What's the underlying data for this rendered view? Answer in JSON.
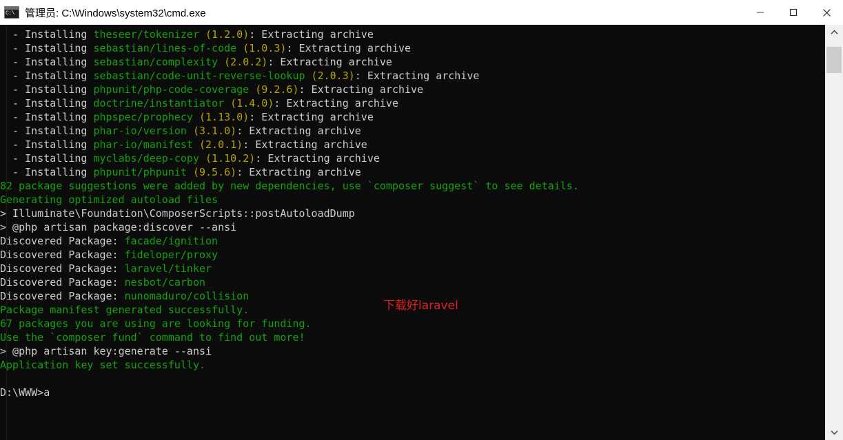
{
  "window": {
    "title": "管理员: C:\\Windows\\system32\\cmd.exe",
    "icon": "cmd-console-icon",
    "icon_prompt": "C:\\",
    "controls": {
      "minimize": "minimize-icon",
      "maximize": "maximize-icon",
      "close": "close-icon"
    }
  },
  "colors": {
    "background": "#0c0c0c",
    "default_text": "#cccccc",
    "green": "#13a10e",
    "yellow": "#b5a300",
    "annotation_red": "#e02020",
    "titlebar_bg": "#ffffff",
    "scrollbar_track": "#f0f0f0",
    "scrollbar_thumb": "#cdcdcd"
  },
  "terminal": {
    "lines": [
      {
        "id": "install-theseer-tokenizer",
        "segments": [
          {
            "text": "  - Installing ",
            "color": "white"
          },
          {
            "text": "theseer/tokenizer",
            "color": "green"
          },
          {
            "text": " ",
            "color": "white"
          },
          {
            "text": "(1.2.0)",
            "color": "yellow"
          },
          {
            "text": ": Extracting archive",
            "color": "white"
          }
        ]
      },
      {
        "id": "install-sebastian-lines-of-code",
        "segments": [
          {
            "text": "  - Installing ",
            "color": "white"
          },
          {
            "text": "sebastian/lines-of-code",
            "color": "green"
          },
          {
            "text": " ",
            "color": "white"
          },
          {
            "text": "(1.0.3)",
            "color": "yellow"
          },
          {
            "text": ": Extracting archive",
            "color": "white"
          }
        ]
      },
      {
        "id": "install-sebastian-complexity",
        "segments": [
          {
            "text": "  - Installing ",
            "color": "white"
          },
          {
            "text": "sebastian/complexity",
            "color": "green"
          },
          {
            "text": " ",
            "color": "white"
          },
          {
            "text": "(2.0.2)",
            "color": "yellow"
          },
          {
            "text": ": Extracting archive",
            "color": "white"
          }
        ]
      },
      {
        "id": "install-sebastian-code-unit-reverse-lookup",
        "segments": [
          {
            "text": "  - Installing ",
            "color": "white"
          },
          {
            "text": "sebastian/code-unit-reverse-lookup",
            "color": "green"
          },
          {
            "text": " ",
            "color": "white"
          },
          {
            "text": "(2.0.3)",
            "color": "yellow"
          },
          {
            "text": ": Extracting archive",
            "color": "white"
          }
        ]
      },
      {
        "id": "install-phpunit-php-code-coverage",
        "segments": [
          {
            "text": "  - Installing ",
            "color": "white"
          },
          {
            "text": "phpunit/php-code-coverage",
            "color": "green"
          },
          {
            "text": " ",
            "color": "white"
          },
          {
            "text": "(9.2.6)",
            "color": "yellow"
          },
          {
            "text": ": Extracting archive",
            "color": "white"
          }
        ]
      },
      {
        "id": "install-doctrine-instantiator",
        "segments": [
          {
            "text": "  - Installing ",
            "color": "white"
          },
          {
            "text": "doctrine/instantiator",
            "color": "green"
          },
          {
            "text": " ",
            "color": "white"
          },
          {
            "text": "(1.4.0)",
            "color": "yellow"
          },
          {
            "text": ": Extracting archive",
            "color": "white"
          }
        ]
      },
      {
        "id": "install-phpspec-prophecy",
        "segments": [
          {
            "text": "  - Installing ",
            "color": "white"
          },
          {
            "text": "phpspec/prophecy",
            "color": "green"
          },
          {
            "text": " ",
            "color": "white"
          },
          {
            "text": "(1.13.0)",
            "color": "yellow"
          },
          {
            "text": ": Extracting archive",
            "color": "white"
          }
        ]
      },
      {
        "id": "install-phar-io-version",
        "segments": [
          {
            "text": "  - Installing ",
            "color": "white"
          },
          {
            "text": "phar-io/version",
            "color": "green"
          },
          {
            "text": " ",
            "color": "white"
          },
          {
            "text": "(3.1.0)",
            "color": "yellow"
          },
          {
            "text": ": Extracting archive",
            "color": "white"
          }
        ]
      },
      {
        "id": "install-phar-io-manifest",
        "segments": [
          {
            "text": "  - Installing ",
            "color": "white"
          },
          {
            "text": "phar-io/manifest",
            "color": "green"
          },
          {
            "text": " ",
            "color": "white"
          },
          {
            "text": "(2.0.1)",
            "color": "yellow"
          },
          {
            "text": ": Extracting archive",
            "color": "white"
          }
        ]
      },
      {
        "id": "install-myclabs-deep-copy",
        "segments": [
          {
            "text": "  - Installing ",
            "color": "white"
          },
          {
            "text": "myclabs/deep-copy",
            "color": "green"
          },
          {
            "text": " ",
            "color": "white"
          },
          {
            "text": "(1.10.2)",
            "color": "yellow"
          },
          {
            "text": ": Extracting archive",
            "color": "white"
          }
        ]
      },
      {
        "id": "install-phpunit-phpunit",
        "segments": [
          {
            "text": "  - Installing ",
            "color": "white"
          },
          {
            "text": "phpunit/phpunit",
            "color": "green"
          },
          {
            "text": " ",
            "color": "white"
          },
          {
            "text": "(9.5.6)",
            "color": "yellow"
          },
          {
            "text": ": Extracting archive",
            "color": "white"
          }
        ]
      },
      {
        "id": "package-suggestions",
        "segments": [
          {
            "text": "82 package suggestions were added by new dependencies, use `composer suggest` to see details.",
            "color": "green"
          }
        ]
      },
      {
        "id": "generating-autoload",
        "segments": [
          {
            "text": "Generating optimized autoload files",
            "color": "green"
          }
        ]
      },
      {
        "id": "composer-scripts-post-autoload-dump",
        "segments": [
          {
            "text": "> Illuminate\\Foundation\\ComposerScripts::postAutoloadDump",
            "color": "white"
          }
        ]
      },
      {
        "id": "artisan-package-discover",
        "segments": [
          {
            "text": "> @php artisan package:discover --ansi",
            "color": "white"
          }
        ]
      },
      {
        "id": "discovered-facade-ignition",
        "segments": [
          {
            "text": "Discovered Package: ",
            "color": "white"
          },
          {
            "text": "facade/ignition",
            "color": "green"
          }
        ]
      },
      {
        "id": "discovered-fideloper-proxy",
        "segments": [
          {
            "text": "Discovered Package: ",
            "color": "white"
          },
          {
            "text": "fideloper/proxy",
            "color": "green"
          }
        ]
      },
      {
        "id": "discovered-laravel-tinker",
        "segments": [
          {
            "text": "Discovered Package: ",
            "color": "white"
          },
          {
            "text": "laravel/tinker",
            "color": "green"
          }
        ]
      },
      {
        "id": "discovered-nesbot-carbon",
        "segments": [
          {
            "text": "Discovered Package: ",
            "color": "white"
          },
          {
            "text": "nesbot/carbon",
            "color": "green"
          }
        ]
      },
      {
        "id": "discovered-nunomaduro-collision",
        "segments": [
          {
            "text": "Discovered Package: ",
            "color": "white"
          },
          {
            "text": "nunomaduro/collision",
            "color": "green"
          }
        ]
      },
      {
        "id": "manifest-generated",
        "segments": [
          {
            "text": "Package manifest generated successfully.",
            "color": "green"
          }
        ]
      },
      {
        "id": "packages-funding",
        "segments": [
          {
            "text": "67 packages you are using are looking for funding.",
            "color": "green"
          }
        ]
      },
      {
        "id": "composer-fund-hint",
        "segments": [
          {
            "text": "Use the `composer fund` command to find out more!",
            "color": "green"
          }
        ]
      },
      {
        "id": "artisan-key-generate",
        "segments": [
          {
            "text": "> @php artisan key:generate --ansi",
            "color": "white"
          }
        ]
      },
      {
        "id": "application-key-set",
        "segments": [
          {
            "text": "Application key set successfully.",
            "color": "green"
          }
        ]
      },
      {
        "id": "blank-1",
        "segments": [
          {
            "text": " ",
            "color": "white"
          }
        ]
      },
      {
        "id": "prompt-line",
        "segments": [
          {
            "text": "D:\\WWW>a",
            "color": "white"
          }
        ]
      }
    ]
  },
  "annotation": {
    "text": "下载好laravel"
  },
  "scrollbars": {
    "vertical": {
      "up_arrow": "chevron-up-icon",
      "down_arrow": "chevron-down-icon"
    }
  }
}
